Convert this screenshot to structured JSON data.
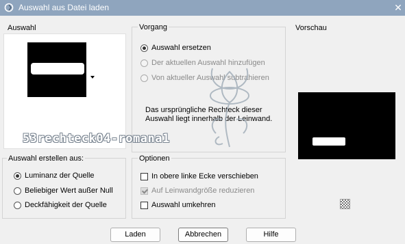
{
  "window": {
    "title": "Auswahl aus Datei laden",
    "close_glyph": "✕",
    "app_icon": "psp-icon"
  },
  "auswahl": {
    "label": "Auswahl"
  },
  "vorgang": {
    "label": "Vorgang",
    "options": [
      {
        "label": "Auswahl ersetzen",
        "checked": true,
        "enabled": true
      },
      {
        "label": "Der aktuellen Auswahl hinzufügen",
        "checked": false,
        "enabled": false
      },
      {
        "label": "Von aktueller Auswahl subtrahieren",
        "checked": false,
        "enabled": false
      }
    ],
    "description": "Das ursprüngliche Rechteck dieser Auswahl liegt innerhalb der Leinwand."
  },
  "vorschau": {
    "label": "Vorschau"
  },
  "watermark_text": "53rechteck04-romana1",
  "auswahl_erstellen": {
    "label": "Auswahl erstellen aus:",
    "options": [
      {
        "label": "Luminanz der Quelle",
        "checked": true
      },
      {
        "label": "Beliebiger Wert außer Null",
        "checked": false
      },
      {
        "label": "Deckfähigkeit der Quelle",
        "checked": false
      }
    ]
  },
  "optionen": {
    "label": "Optionen",
    "items": [
      {
        "label": "In obere linke Ecke verschieben",
        "checked": false,
        "enabled": true
      },
      {
        "label": "Auf Leinwandgröße reduzieren",
        "checked": true,
        "enabled": false
      },
      {
        "label": "Auswahl umkehren",
        "checked": false,
        "enabled": true
      }
    ]
  },
  "buttons": {
    "load": "Laden",
    "cancel": "Abbrechen",
    "help": "Hilfe"
  }
}
